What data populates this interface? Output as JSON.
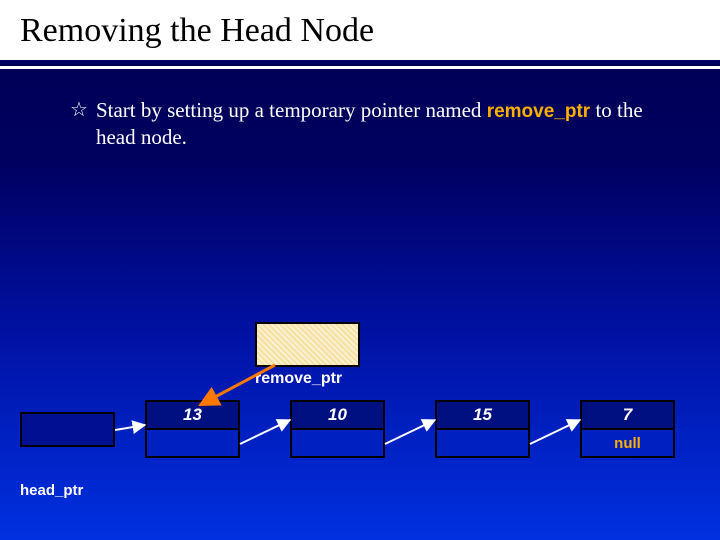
{
  "title": "Removing the Head Node",
  "bullet": {
    "pre": "Start by setting up a temporary pointer named ",
    "kw": "remove_ptr",
    "post": " to the head node."
  },
  "remove_ptr_label": "remove_ptr",
  "head_ptr_label": "head_ptr",
  "nodes": [
    {
      "value": "13",
      "next": ""
    },
    {
      "value": "10",
      "next": ""
    },
    {
      "value": "15",
      "next": ""
    },
    {
      "value": "7",
      "next": "null"
    }
  ]
}
